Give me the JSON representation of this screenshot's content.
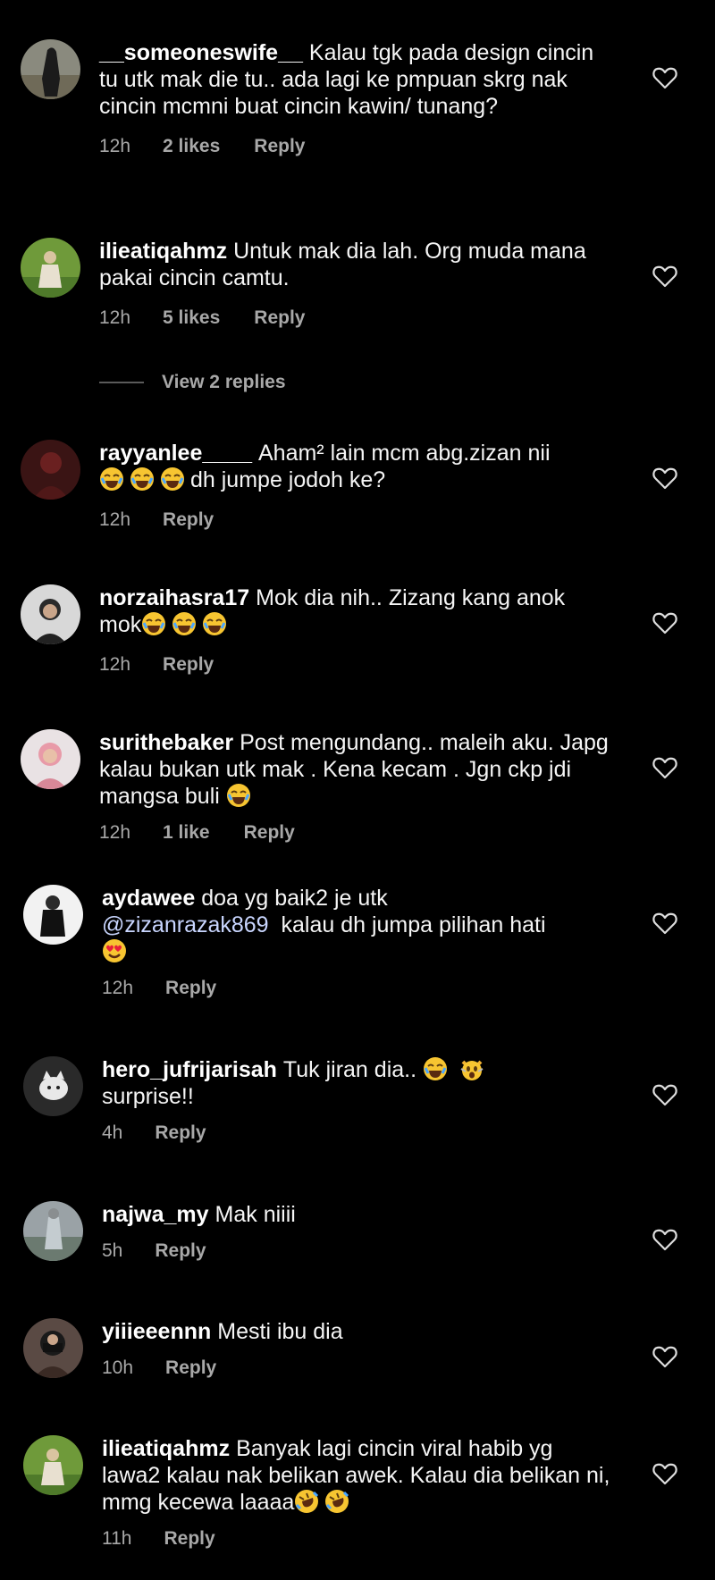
{
  "comments": [
    {
      "username": "__someoneswife__",
      "text": "Kalau tgk pada design cincin tu utk mak die tu.. ada lagi ke pmpuan skrg nak cincin mcmni buat cincin kawin/ tunang?",
      "time": "12h",
      "likes": "2 likes",
      "reply": "Reply"
    },
    {
      "username": "ilieatiqahmz",
      "text": "Untuk mak dia lah. Org muda mana pakai cincin camtu.",
      "time": "12h",
      "likes": "5 likes",
      "reply": "Reply"
    },
    {
      "username": "rayyanlee____",
      "text": "Aham² lain mcm abg.zizan nii",
      "text_after_emoji": "dh jumpe jodoh ke?",
      "time": "12h",
      "reply": "Reply"
    },
    {
      "username": "norzaihasra17",
      "text": "Mok dia nih.. Zizang kang anok mok",
      "time": "12h",
      "reply": "Reply"
    },
    {
      "username": "surithebaker",
      "text": "Post mengundang.. maleih aku. Japg kalau bukan utk mak . Kena kecam . Jgn ckp jdi mangsa buli",
      "time": "12h",
      "likes": "1 like",
      "reply": "Reply"
    },
    {
      "username": "aydawee",
      "text": "doa yg baik2 je utk",
      "mention": "@zizanrazak869",
      "text_after_mention": "kalau dh jumpa pilihan hati",
      "time": "12h",
      "reply": "Reply"
    },
    {
      "username": "hero_jufrijarisah",
      "text": "Tuk jiran dia..",
      "text_after_emoji": "surprise!!",
      "time": "4h",
      "reply": "Reply"
    },
    {
      "username": "najwa_my",
      "text": "Mak niiii",
      "time": "5h",
      "reply": "Reply"
    },
    {
      "username": "yiiieeennn",
      "text": "Mesti ibu dia",
      "time": "10h",
      "reply": "Reply"
    },
    {
      "username": "ilieatiqahmz",
      "text": "Banyak lagi cincin viral habib yg lawa2 kalau nak belikan awek. Kalau dia belikan ni, mmg kecewa laaaa",
      "time": "11h",
      "reply": "Reply"
    }
  ],
  "view_replies_label": "View 2 replies",
  "icons": {
    "like": "heart-outline-icon"
  },
  "colors": {
    "background": "#000000",
    "meta_text": "#a8a8a8",
    "mention": "#c9d6ff"
  }
}
